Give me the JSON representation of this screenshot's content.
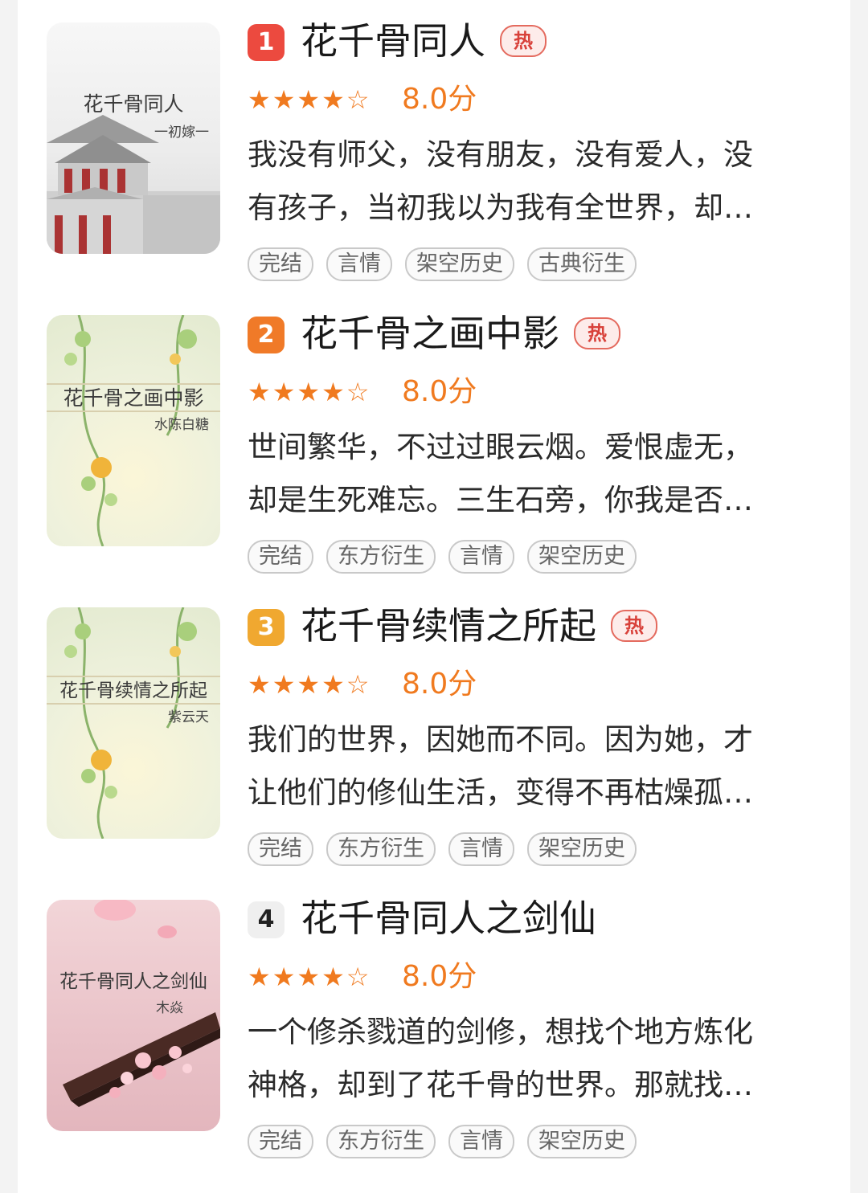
{
  "colors": {
    "rank1": "#ec4a3f",
    "rank2": "#f07a28",
    "rank3": "#f0a830",
    "rank4_bg": "#efefef",
    "rating": "#f07a1f",
    "hot": "#d8413a"
  },
  "items": [
    {
      "rank": "1",
      "title": "花千骨同人",
      "hot_label": "热",
      "stars": "★★★★☆",
      "rating_value": 4,
      "score": "8.0分",
      "desc_line1": "我没有师父，没有朋友，没有爱人，没",
      "desc_line2": "有孩子，当初我以为我有全世界，却…",
      "tags": [
        "完结",
        "言情",
        "架空历史",
        "古典衍生"
      ],
      "cover_title": "花千骨同人",
      "cover_author": "一初嫁一"
    },
    {
      "rank": "2",
      "title": "花千骨之画中影",
      "hot_label": "热",
      "stars": "★★★★☆",
      "rating_value": 4,
      "score": "8.0分",
      "desc_line1": "世间繁华，不过过眼云烟。爱恨虚无，",
      "desc_line2": "却是生死难忘。三生石旁，你我是否…",
      "tags": [
        "完结",
        "东方衍生",
        "言情",
        "架空历史"
      ],
      "cover_title": "花千骨之画中影",
      "cover_author": "水陈白糖"
    },
    {
      "rank": "3",
      "title": "花千骨续情之所起",
      "hot_label": "热",
      "stars": "★★★★☆",
      "rating_value": 4,
      "score": "8.0分",
      "desc_line1": "我们的世界，因她而不同。因为她，才",
      "desc_line2": "让他们的修仙生活，变得不再枯燥孤…",
      "tags": [
        "完结",
        "东方衍生",
        "言情",
        "架空历史"
      ],
      "cover_title": "花千骨续情之所起",
      "cover_author": "紫云天"
    },
    {
      "rank": "4",
      "title": "花千骨同人之剑仙",
      "stars": "★★★★☆",
      "rating_value": 4,
      "score": "8.0分",
      "desc_line1": "一个修杀戮道的剑修，想找个地方炼化",
      "desc_line2": "神格，却到了花千骨的世界。那就找…",
      "tags": [
        "完结",
        "东方衍生",
        "言情",
        "架空历史"
      ],
      "cover_title": "花千骨同人之剑仙",
      "cover_author": "木焱"
    }
  ]
}
